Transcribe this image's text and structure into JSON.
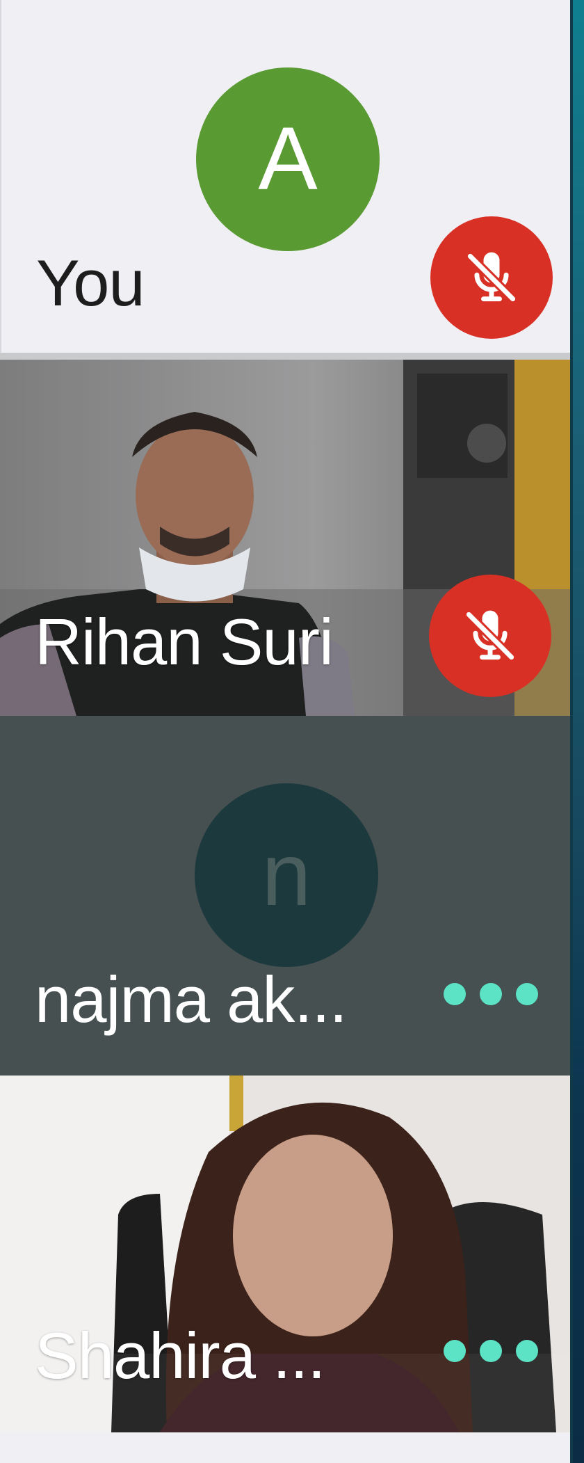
{
  "participants": [
    {
      "name": "You",
      "avatar_letter": "A",
      "avatar_color": "#5a9a32",
      "status": "muted",
      "video": false
    },
    {
      "name": "Rihan Suri",
      "status": "muted",
      "video": true
    },
    {
      "name": "najma ak...",
      "avatar_letter": "n",
      "avatar_color": "#1c3a3e",
      "status": "more-options",
      "video": false
    },
    {
      "name": "Shahira ...",
      "status": "more-options",
      "video": true
    }
  ],
  "icons": {
    "muted": "mic-off-icon",
    "more": "more-dots-icon"
  },
  "colors": {
    "mute_red": "#d93025",
    "dots_teal": "#5ce3c5"
  }
}
